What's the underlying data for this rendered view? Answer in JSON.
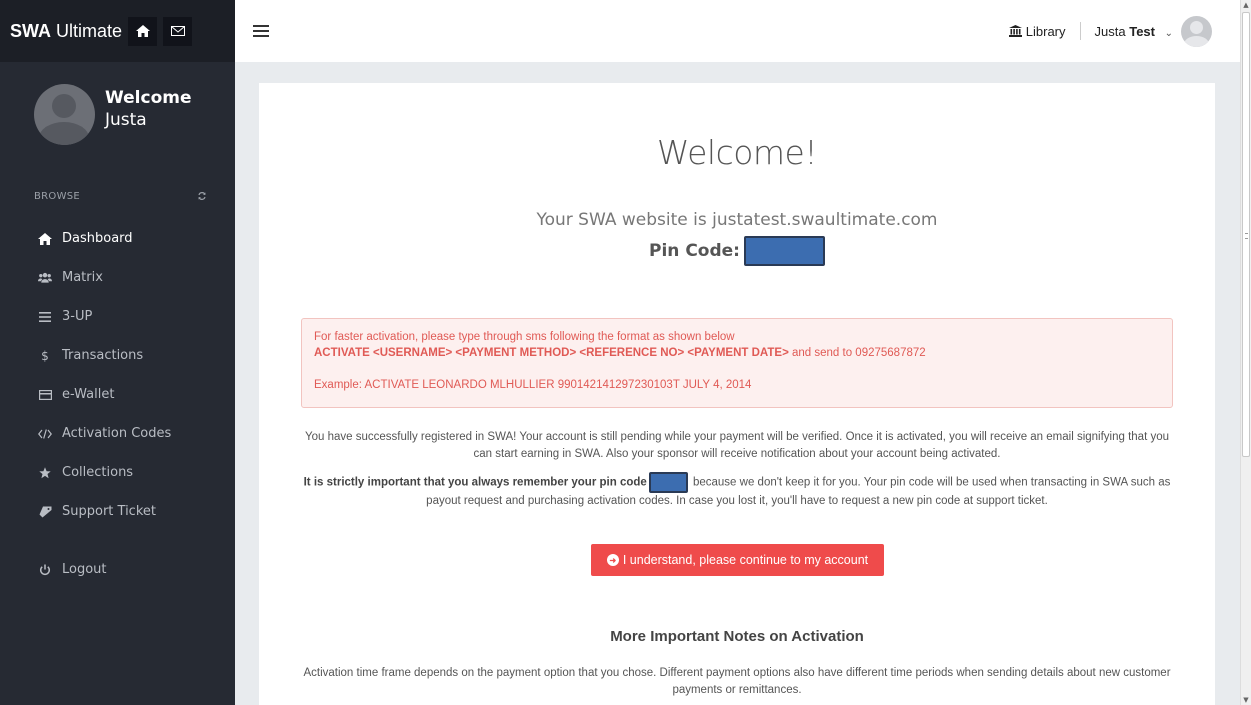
{
  "brand": {
    "bold": "SWA",
    "rest": " Ultimate",
    "home_icon": "home-icon",
    "mail_icon": "mail-icon"
  },
  "sidebar": {
    "welcome_title": "Welcome",
    "welcome_name": "Justa",
    "browse_label": "BROWSE",
    "items": [
      {
        "label": "Dashboard",
        "icon": "home-icon",
        "active": true
      },
      {
        "label": "Matrix",
        "icon": "users-icon"
      },
      {
        "label": "3-UP",
        "icon": "bars-icon"
      },
      {
        "label": "Transactions",
        "icon": "dollar-icon"
      },
      {
        "label": "e-Wallet",
        "icon": "credit-card-icon"
      },
      {
        "label": "Activation Codes",
        "icon": "code-icon"
      },
      {
        "label": "Collections",
        "icon": "star-icon"
      },
      {
        "label": "Support Ticket",
        "icon": "ticket-icon"
      }
    ],
    "logout": "Logout"
  },
  "topbar": {
    "library": "Library",
    "user_first": "Justa",
    "user_last": "Test"
  },
  "main": {
    "heading": "Welcome!",
    "site_line": "Your SWA website is justatest.swaultimate.com",
    "pin_label": "Pin Code:",
    "alert": {
      "line1": "For faster activation, please type through sms following the format as shown below",
      "line2": "ACTIVATE <USERNAME> <PAYMENT METHOD> <REFERENCE NO> <PAYMENT DATE>",
      "line2_rest": " and send to 09275687872",
      "example": "Example: ACTIVATE LEONARDO MLHULLIER 990142141297230103T JULY 4, 2014"
    },
    "p1": "You have successfully registered in SWA! Your account is still pending while your payment will be verified. Once it is activated, you will receive an email signifying that you can start earning in SWA. Also your sponsor will receive notification about your account being activated.",
    "p2_bold": "It is strictly important that you always remember your pin code",
    "p2_rest": " because we don't keep it for you. Your pin code will be used when transacting in SWA such as payout request and purchasing activation codes. In case you lost it, you'll have to request a new pin code at support ticket.",
    "cta": "I understand, please continue to my account",
    "notes_heading": "More Important Notes on Activation",
    "p3": "Activation time frame depends on the payment option that you chose. Different payment options also have different time periods when sending details about new customer payments or remittances."
  }
}
